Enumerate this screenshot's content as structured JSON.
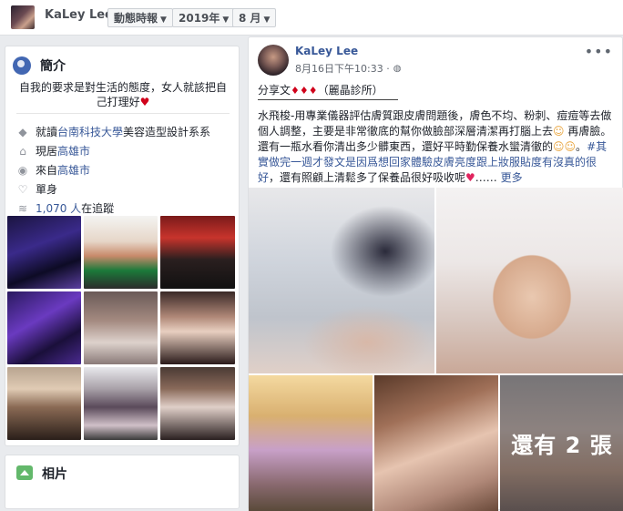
{
  "topbar": {
    "name": "KaLey Lee",
    "dropdowns": [
      {
        "label": "動態時報"
      },
      {
        "label": "2019年"
      },
      {
        "label": "8 月"
      }
    ]
  },
  "intro": {
    "title": "簡介",
    "bio": "自我的要求是對生活的態度，女人就該把自己打理好",
    "rows": [
      {
        "icon": "graduation-cap-icon",
        "prefix": "就讀",
        "link": "台南科技大學",
        "suffix": "美容造型設計系系"
      },
      {
        "icon": "home-icon",
        "prefix": "現居",
        "link": "高雄市",
        "suffix": ""
      },
      {
        "icon": "location-pin-icon",
        "prefix": "來自",
        "link": "高雄市",
        "suffix": ""
      },
      {
        "icon": "heart-icon",
        "prefix": "單身",
        "link": "",
        "suffix": ""
      },
      {
        "icon": "follow-icon",
        "prefix": "",
        "link": "1,070 人",
        "suffix": "在追蹤"
      }
    ]
  },
  "photos": {
    "title": "相片"
  },
  "post": {
    "author": "KaLey Lee",
    "timestamp": "8月16日下午10:33 ·",
    "share_prefix": "分享文",
    "share_suffix": "（麗晶診所）",
    "text_main": "水飛梭-用專業儀器評估膚質跟皮膚問題後，膚色不均、粉刺、痘痘等去做個人調整，主要是非常徹底的幫你做臉部深層清潔再打腦上去",
    "text_main2": " 再膚臉。還有一瓶水看你清出多少髒東西，還好平時勤保養水蠻清徹的",
    "hashtag": "#其實做完一週才發文是因爲想回家體驗皮膚亮度跟上妝服貼度有沒真的很好",
    "text_after": "，還有照顧上清鬆多了保養品很好吸收呢",
    "ellipsis": "……",
    "see_more": "更多",
    "more_photos_overlay": "還有 2 張"
  }
}
